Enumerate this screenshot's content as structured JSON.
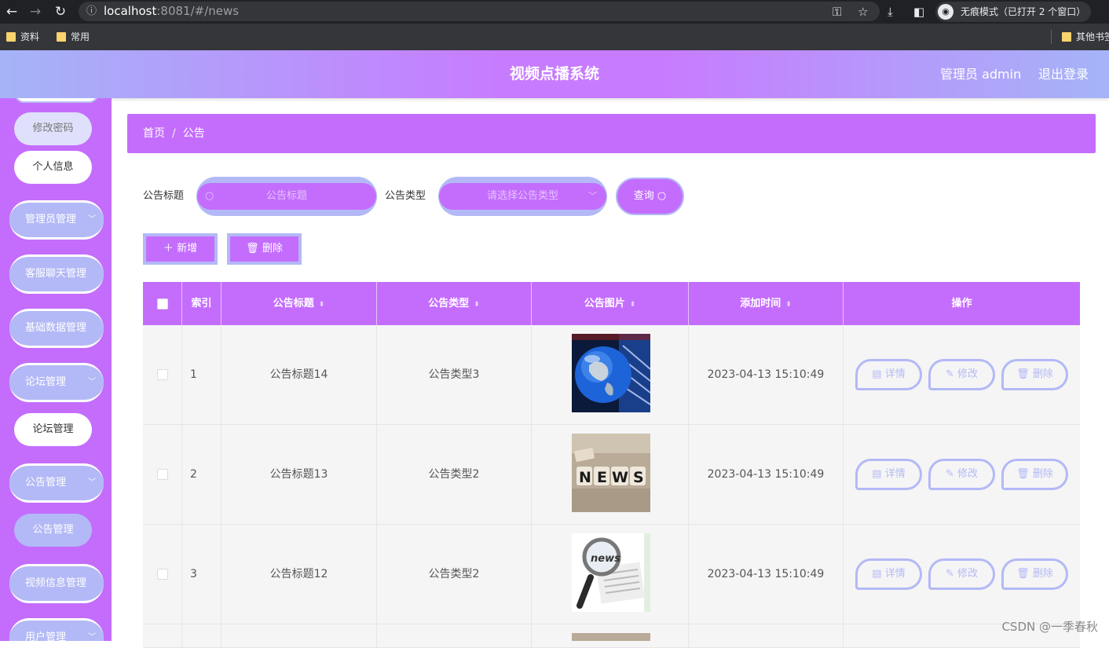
{
  "browser": {
    "url_host": "localhost",
    "url_rest": ":8081/#/news",
    "incognito_label": "无痕模式（已打开 2 个窗口）",
    "bookmarks": [
      "资料",
      "常用"
    ],
    "other_bookmarks": "其他书签"
  },
  "header": {
    "title": "视频点播系统",
    "user": "管理员 admin",
    "logout": "退出登录"
  },
  "sidebar": {
    "change_password": "修改密码",
    "personal_info": "个人信息",
    "groups": [
      {
        "label": "管理员管理"
      },
      {
        "label": "客服聊天管理"
      },
      {
        "label": "基础数据管理"
      },
      {
        "label": "论坛管理",
        "sub": "论坛管理"
      },
      {
        "label": "公告管理",
        "sub": "公告管理"
      },
      {
        "label": "视频信息管理"
      },
      {
        "label": "用户管理"
      }
    ]
  },
  "breadcrumb": {
    "home": "首页",
    "current": "公告"
  },
  "search": {
    "title_label": "公告标题",
    "title_placeholder": "公告标题",
    "type_label": "公告类型",
    "type_placeholder": "请选择公告类型",
    "query_button": "查询"
  },
  "actions": {
    "add": "新增",
    "delete": "删除"
  },
  "table": {
    "columns": [
      "索引",
      "公告标题",
      "公告类型",
      "公告图片",
      "添加时间",
      "操作"
    ],
    "rows": [
      {
        "index": "1",
        "title": "公告标题14",
        "type": "公告类型3",
        "image": "globe-news-image",
        "time": "2023-04-13 15:10:49"
      },
      {
        "index": "2",
        "title": "公告标题13",
        "type": "公告类型2",
        "image": "news-blocks-image",
        "time": "2023-04-13 15:10:49"
      },
      {
        "index": "3",
        "title": "公告标题12",
        "type": "公告类型2",
        "image": "magnifier-news-image",
        "time": "2023-04-13 15:10:49"
      }
    ],
    "row_actions": {
      "detail": "详情",
      "edit": "修改",
      "delete": "删除"
    }
  },
  "watermark": "CSDN @一季春秋",
  "colors": {
    "primary": "#c46dfd",
    "secondary": "#b3b9f6"
  }
}
